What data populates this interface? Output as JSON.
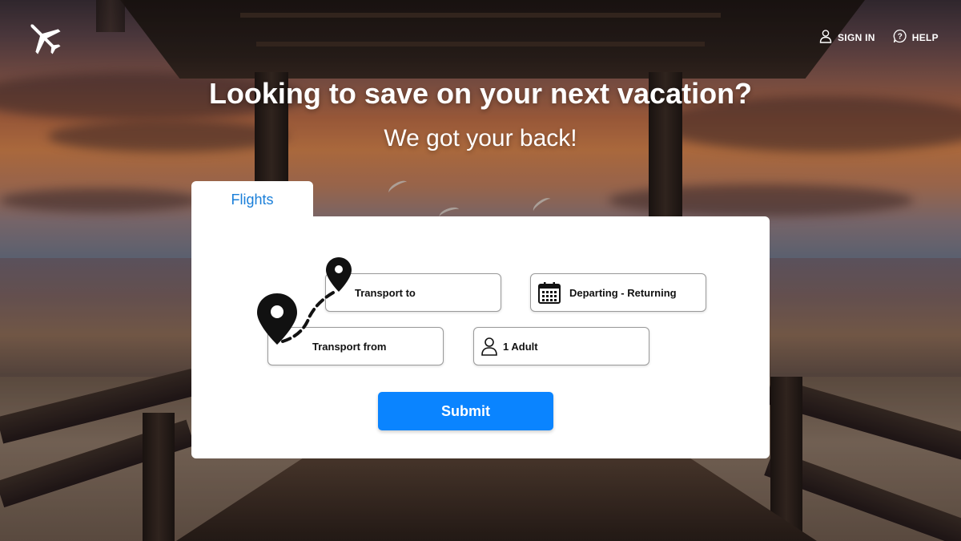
{
  "nav": {
    "logo_icon": "airplane-icon",
    "sign_in_label": "SIGN IN",
    "sign_in_icon": "user-icon",
    "help_label": "HELP",
    "help_icon": "question-icon"
  },
  "hero": {
    "title": "Looking to save on your next vacation?",
    "subtitle": "We got your back!"
  },
  "search": {
    "active_tab": "Flights",
    "transport_to": "Transport to",
    "transport_from": "Transport from",
    "dates": "Departing - Returning",
    "dates_icon": "calendar-icon",
    "travelers": "1 Adult",
    "travelers_icon": "person-icon",
    "route_icon": "route-pins-icon",
    "submit_label": "Submit"
  },
  "colors": {
    "accent": "#0a84ff",
    "tab_text": "#1a7fd9",
    "card": "#ffffff"
  }
}
